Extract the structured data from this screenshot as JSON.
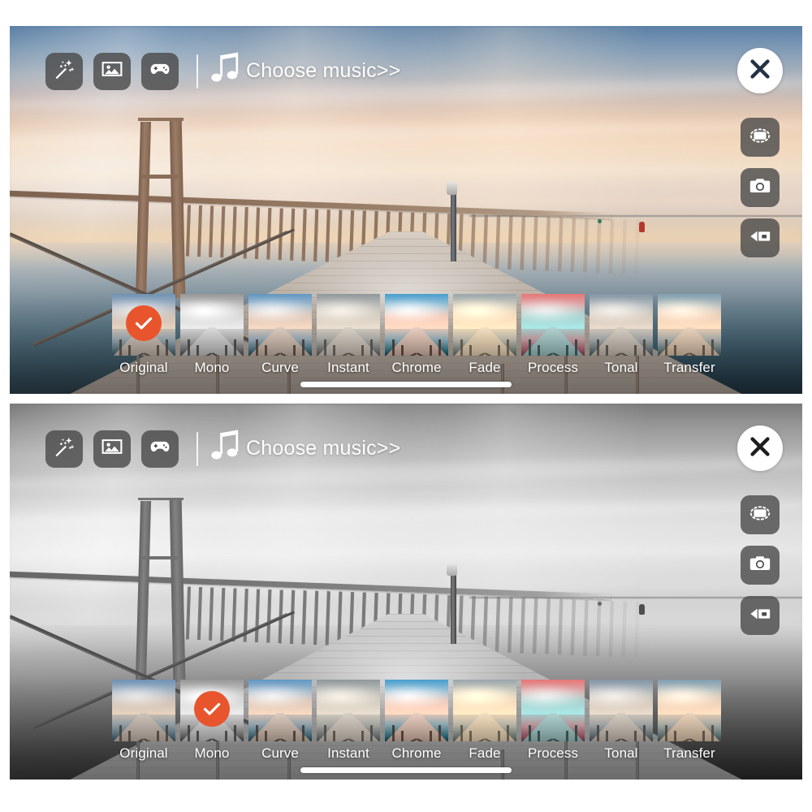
{
  "app": {
    "accent_orange": "#e8552d",
    "panel_count": 2
  },
  "toolbar": {
    "magic_wand_label": "magic-wand",
    "photo_label": "photo",
    "game_label": "game",
    "music_label": "Choose music>>"
  },
  "side_controls": {
    "close_label": "close",
    "crop_label": "crop-rotate",
    "camera_label": "camera",
    "video_label": "video-camera"
  },
  "filters": {
    "items": [
      {
        "label": "Original",
        "class": "f-original"
      },
      {
        "label": "Mono",
        "class": "f-mono"
      },
      {
        "label": "Curve",
        "class": "f-curve"
      },
      {
        "label": "Instant",
        "class": "f-instant"
      },
      {
        "label": "Chrome",
        "class": "f-chrome"
      },
      {
        "label": "Fade",
        "class": "f-fade"
      },
      {
        "label": "Process",
        "class": "f-process"
      },
      {
        "label": "Tonal",
        "class": "f-tonal"
      },
      {
        "label": "Transfer",
        "class": "f-transfer"
      }
    ]
  },
  "panels": [
    {
      "id": "panel-color",
      "selected_filter": "Original",
      "selected_index": 0,
      "preview_mode": "color"
    },
    {
      "id": "panel-mono",
      "selected_filter": "Mono",
      "selected_index": 1,
      "preview_mode": "grayscale"
    }
  ]
}
